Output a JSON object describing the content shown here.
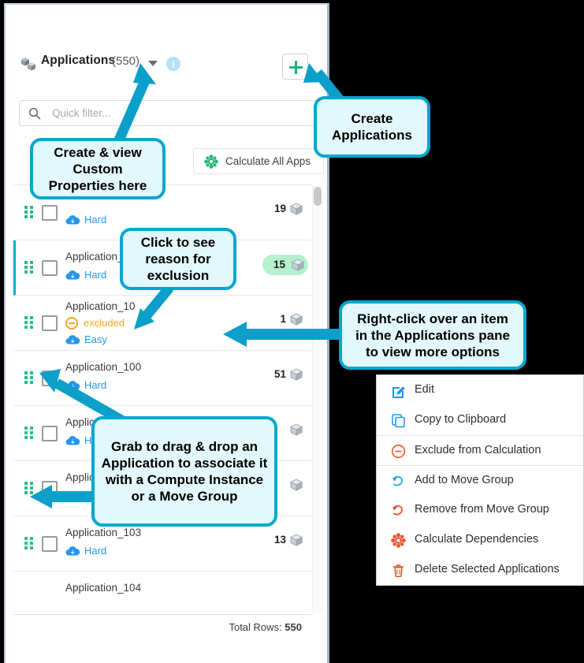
{
  "panel": {
    "header": {
      "icon": "cubes-icon",
      "title": "Applications",
      "count": "(550)",
      "info_icon": "info-icon",
      "caret_icon": "chevron-down-icon",
      "add_button_icon": "plus-icon"
    },
    "filter": {
      "icon": "search-icon",
      "placeholder": "Quick filter..."
    },
    "toolbar": {
      "calculate_all_label": "Calculate All Apps",
      "calculate_all_icon": "gear-icon"
    },
    "rows": [
      {
        "name": "",
        "difficulty": "Hard",
        "count": "19",
        "badge": false,
        "excluded": false,
        "selected": false
      },
      {
        "name": "Application_1",
        "difficulty": "Hard",
        "count": "15",
        "badge": true,
        "excluded": false,
        "selected": true
      },
      {
        "name": "Application_10",
        "difficulty": "Easy",
        "count": "1",
        "badge": false,
        "excluded": true,
        "excluded_label": "excluded",
        "selected": false
      },
      {
        "name": "Application_100",
        "difficulty": "Hard",
        "count": "51",
        "badge": false,
        "excluded": false,
        "selected": false
      },
      {
        "name": "Application_101",
        "difficulty": "Hard",
        "count": "",
        "badge": false,
        "excluded": false,
        "selected": false
      },
      {
        "name": "Application_102",
        "difficulty": "Hard",
        "count": "",
        "badge": false,
        "excluded": false,
        "selected": false
      },
      {
        "name": "Application_103",
        "difficulty": "Hard",
        "count": "13",
        "badge": false,
        "excluded": false,
        "selected": false
      },
      {
        "name": "Application_104",
        "difficulty": "",
        "count": "",
        "badge": false,
        "excluded": false,
        "selected": false
      }
    ],
    "footer": {
      "total_rows_label": "Total Rows:",
      "total_rows_value": "550"
    }
  },
  "context_menu": {
    "items": [
      {
        "label": "Edit",
        "icon": "edit-pencil-icon",
        "color": "#2196f3"
      },
      {
        "label": "Copy to Clipboard",
        "icon": "copy-icon",
        "color": "#2196f3"
      },
      {
        "label": "Exclude from Calculation",
        "icon": "minus-circle-icon",
        "color": "#e8542a"
      },
      {
        "label": "Add to Move Group",
        "icon": "arrow-curve-add-icon",
        "color": "#29a8e0"
      },
      {
        "label": "Remove from Move Group",
        "icon": "arrow-curve-remove-icon",
        "color": "#e8542a"
      },
      {
        "label": "Calculate Dependencies",
        "icon": "gear-icon",
        "color": "#e8542a"
      },
      {
        "label": "Delete Selected Applications",
        "icon": "trash-icon",
        "color": "#e8542a"
      }
    ]
  },
  "callouts": [
    {
      "id": "create-applications",
      "text": "Create\nApplications"
    },
    {
      "id": "custom-properties",
      "text": "Create & view\nCustom\nProperties here"
    },
    {
      "id": "exclusion-reason",
      "text": "Click to see\nreason for\nexclusion"
    },
    {
      "id": "right-click-options",
      "text": "Right-click over an item\nin the Applications pane\nto view more options"
    },
    {
      "id": "drag-drop",
      "text": "Grab to drag & drop an\nApplication to associate it\nwith a Compute Instance\nor a Move Group"
    }
  ],
  "colors": {
    "callout_fill": "#e2f8fd",
    "callout_border": "#00a7cf",
    "accent_green": "#19b37e",
    "link_blue": "#2196f3",
    "excluded_orange": "#f5a623",
    "badge_green": "#b6f0ce",
    "danger_orange": "#e8542a"
  }
}
